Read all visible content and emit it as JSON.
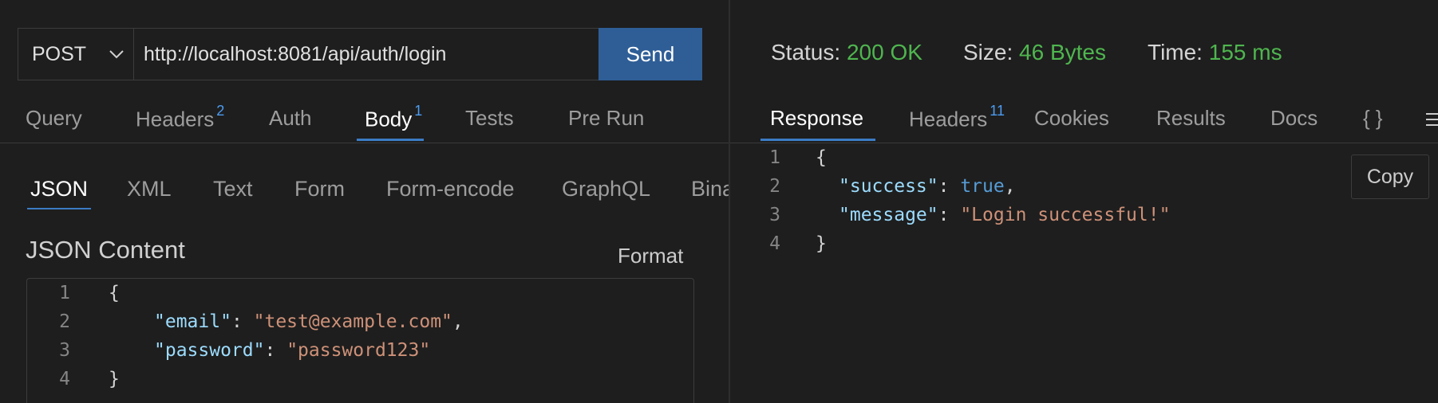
{
  "request": {
    "method": "POST",
    "url": "http://localhost:8081/api/auth/login",
    "send_label": "Send"
  },
  "request_tabs": [
    {
      "label": "Query",
      "badge": ""
    },
    {
      "label": "Headers",
      "badge": "2"
    },
    {
      "label": "Auth",
      "badge": ""
    },
    {
      "label": "Body",
      "badge": "1"
    },
    {
      "label": "Tests",
      "badge": ""
    },
    {
      "label": "Pre Run",
      "badge": ""
    }
  ],
  "body_tabs": [
    "JSON",
    "XML",
    "Text",
    "Form",
    "Form-encode",
    "GraphQL",
    "Bina"
  ],
  "json_content": {
    "title": "JSON Content",
    "format_label": "Format",
    "lines": [
      {
        "n": "1",
        "text": "{"
      },
      {
        "n": "2",
        "key": "\"email\"",
        "value": "\"test@example.com\"",
        "trail": ","
      },
      {
        "n": "3",
        "key": "\"password\"",
        "value": "\"password123\"",
        "trail": ""
      },
      {
        "n": "4",
        "text": "}"
      }
    ]
  },
  "status": {
    "status_label": "Status:",
    "status_value": "200 OK",
    "size_label": "Size:",
    "size_value": "46 Bytes",
    "time_label": "Time:",
    "time_value": "155 ms"
  },
  "response_tabs": [
    {
      "label": "Response",
      "badge": ""
    },
    {
      "label": "Headers",
      "badge": "11"
    },
    {
      "label": "Cookies",
      "badge": ""
    },
    {
      "label": "Results",
      "badge": ""
    },
    {
      "label": "Docs",
      "badge": ""
    },
    {
      "label": "{ }",
      "badge": ""
    }
  ],
  "response_body": {
    "copy_label": "Copy",
    "lines": [
      {
        "n": "1",
        "text": "{"
      },
      {
        "n": "2",
        "key": "\"success\"",
        "value": "true",
        "trail": ","
      },
      {
        "n": "3",
        "key": "\"message\"",
        "value": "\"Login successful!\"",
        "trail": ""
      },
      {
        "n": "4",
        "text": "}"
      }
    ]
  },
  "colors": {
    "background": "#1e1e1e",
    "accent": "#3b7cc5",
    "send_button": "#2f5e96",
    "status_ok": "#4fb64f",
    "json_key": "#9cdcfe",
    "json_string": "#ce9178",
    "json_boolean": "#569cd6"
  }
}
